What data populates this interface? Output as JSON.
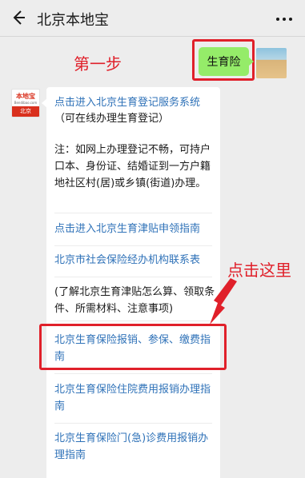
{
  "header": {
    "title": "北京本地宝",
    "back_icon": "back-arrow-icon",
    "more_icon": "more-dots-icon"
  },
  "annotations": {
    "step_one": "第一步",
    "click_here": "点击这里",
    "color": "#e0202a"
  },
  "sent_message": {
    "text": "生育险",
    "bubble_color": "#95ec69"
  },
  "bot": {
    "avatar_logo": "本地宝",
    "avatar_sub": "Bendibao.com",
    "avatar_tag": "北京"
  },
  "reply": {
    "link_color": "#2f72b8",
    "link1": "点击进入北京生育登记服务系统",
    "link1_note": "（可在线办理生育登记）",
    "note": "注：如网上办理登记不畅，可持户口本、身份证、结婚证到一方户籍地社区村(居)或乡镇(街道)办理。",
    "link2": "点击进入北京生育津贴申领指南",
    "link3": "北京市社会保险经办机构联系表",
    "info": "(了解北京生育津贴怎么算、领取条件、所需材料、注意事项)",
    "link4": "北京生育保险报销、参保、缴费指南",
    "link5": "北京生育保险住院费用报销办理指南",
    "link6": "北京生育保险门(急)诊费用报销办理指南"
  }
}
